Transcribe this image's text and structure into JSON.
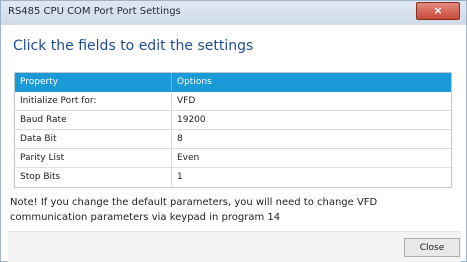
{
  "window": {
    "title": "RS485 CPU COM Port Port Settings",
    "close_glyph": "×"
  },
  "heading": "Click the fields to edit the settings",
  "table": {
    "columns": [
      "Property",
      "Options"
    ],
    "rows": [
      {
        "property": "Initialize Port for:",
        "option": "VFD"
      },
      {
        "property": "Baud Rate",
        "option": "19200"
      },
      {
        "property": "Data Bit",
        "option": "8"
      },
      {
        "property": "Parity List",
        "option": "Even"
      },
      {
        "property": "Stop Bits",
        "option": "1"
      }
    ]
  },
  "note": {
    "line1": "Note! If you change the default parameters, you will need to change VFD",
    "line2": "communication parameters via keypad in program 14"
  },
  "footer": {
    "close_label": "Close"
  },
  "colors": {
    "header_bg": "#1a9ad6",
    "heading_text": "#1f4e8f",
    "title_close_bg": "#c84a3a"
  }
}
